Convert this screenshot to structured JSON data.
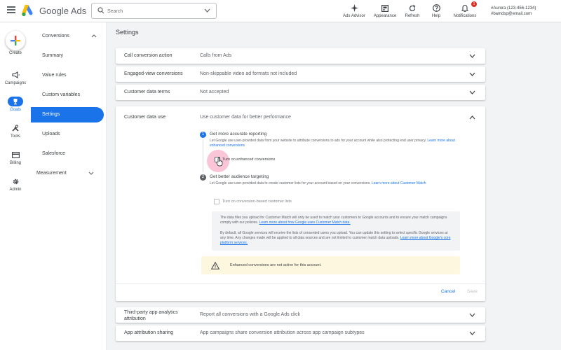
{
  "header": {
    "brand": "Google Ads",
    "search_placeholder": "Search",
    "tools": [
      {
        "label": "Ads Advisor",
        "icon": "sparkle-icon"
      },
      {
        "label": "Appearance",
        "icon": "appearance-icon"
      },
      {
        "label": "Refresh",
        "icon": "refresh-icon"
      },
      {
        "label": "Help",
        "icon": "help-icon"
      },
      {
        "label": "Notifications",
        "icon": "bell-icon",
        "badge": "1"
      }
    ],
    "account_line1": "#Aurora (123-456-1234)",
    "account_line2": "#bamdsp@email.com"
  },
  "rail": {
    "create": "Create",
    "items": [
      {
        "label": "Campaigns",
        "icon": "megaphone-icon"
      },
      {
        "label": "Goals",
        "icon": "trophy-icon"
      },
      {
        "label": "Tools",
        "icon": "tools-icon"
      },
      {
        "label": "Billing",
        "icon": "card-icon"
      },
      {
        "label": "Admin",
        "icon": "gear-icon"
      }
    ]
  },
  "nav": {
    "section": "Conversions",
    "items": [
      "Summary",
      "Value rules",
      "Custom variables",
      "Settings",
      "Uploads",
      "Salesforce"
    ],
    "active": "Settings",
    "section2": "Measurement"
  },
  "page_title": "Settings",
  "rows": [
    {
      "label": "Call conversion action",
      "value": "Calls from Ads"
    },
    {
      "label": "Engaged-view conversions",
      "value": "Non-skippable video ad formats not included"
    },
    {
      "label": "Customer data terms",
      "value": "Not accepted"
    }
  ],
  "customer_data": {
    "label": "Customer data use",
    "value": "Use customer data for better performance",
    "step1": {
      "num": "1",
      "title": "Get more accurate reporting",
      "desc": "Let Google use user-provided data from your website to attribute conversions to ads for your account while also protecting end user privacy.",
      "link": "Learn more about enhanced conversions",
      "checkbox": "Turn on enhanced conversions"
    },
    "step2": {
      "num": "2",
      "title": "Get better audience targeting",
      "desc": "Let Google use user-provided data to create customer lists for your account based on your conversions.",
      "link": "Learn more about Customer Match",
      "checkbox": "Turn on conversion-based customer lists"
    },
    "info1": "The data files you upload for Customer Match will only be used to match your customers to Google accounts and to ensure your match campaigns comply with our policies.",
    "info1_link": "Learn more about how Google uses Customer Match data.",
    "info2": "By default, all Google services will receive the lists of consented users you upload. You can update this setting to select specific Google services at any time. Any changes made will be applied to all data sources and are not limited to customer match data uploads.",
    "info2_link": "Learn more about Google's core platform services.",
    "warning": "Enhanced conversions are not active for this account.",
    "cancel": "Cancel",
    "save": "Save"
  },
  "rows2": [
    {
      "label": "Third-party app analytics attribution",
      "value": "Report all conversions with a Google Ads click"
    },
    {
      "label": "App attribution sharing",
      "value": "App campaigns share conversion attribution across app campaign subtypes"
    }
  ],
  "colors": {
    "accent": "#1a73e8",
    "warning_bg": "#fef7e0",
    "cursor_highlight": "#f48fb1"
  }
}
